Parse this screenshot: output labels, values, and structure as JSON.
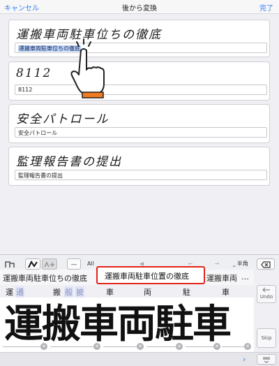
{
  "navbar": {
    "cancel": "キャンセル",
    "title": "後から変換",
    "done": "完了"
  },
  "cards": [
    {
      "handwriting": "運搬車両駐車位ちの徹底",
      "field_value": "運搬車両駐車位ちの徹底"
    },
    {
      "handwriting": "8112",
      "field_value": "8112"
    },
    {
      "handwriting": "安全パトロール",
      "field_value": "安全パトロール"
    },
    {
      "handwriting": "監理報告書の提出",
      "field_value": "監理報告書の提出"
    }
  ],
  "toolbar": {
    "all_label": "All",
    "dash_label": "―",
    "hankaku_label": "半角"
  },
  "candidates": {
    "first": "運搬車両駐車位ちの徹底",
    "selected": "運搬車両駐車位置の徹底",
    "third": "運搬車両",
    "more": "…"
  },
  "char_candidates": {
    "c1": "運",
    "c1_alt": "通",
    "c2": "搬",
    "c2_alt1": "般",
    "c2_alt2": "披",
    "c3": "車",
    "c4": "両",
    "c5": "駐",
    "c6": "車"
  },
  "handwriting_input": "運搬車両駐車",
  "side_keys": {
    "undo": "Undo",
    "skip": "Skip"
  },
  "colors": {
    "accent": "#2f7df6",
    "selection_border": "#e2231a"
  }
}
